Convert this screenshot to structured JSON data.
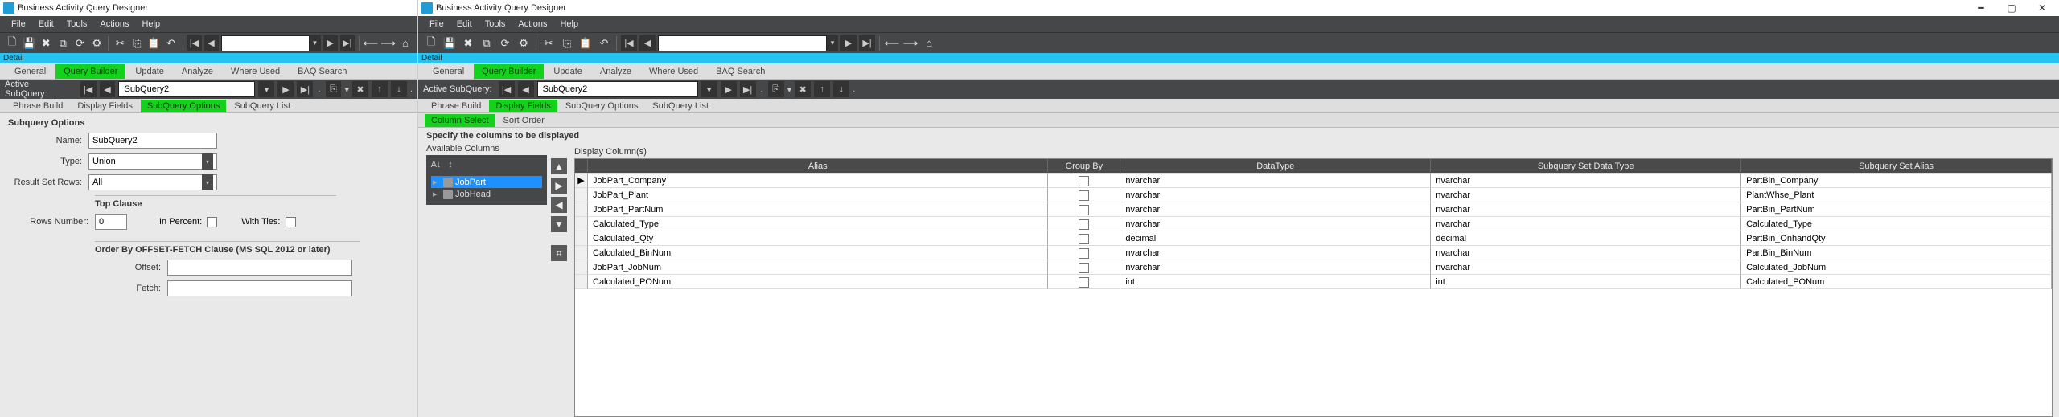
{
  "app_title": "Business Activity Query Designer",
  "menu": [
    "File",
    "Edit",
    "Tools",
    "Actions",
    "Help"
  ],
  "detail_label": "Detail",
  "main_tabs": [
    "General",
    "Query Builder",
    "Update",
    "Analyze",
    "Where Used",
    "BAQ Search"
  ],
  "main_tab_active": 1,
  "subq_label": "Active SubQuery:",
  "subq_value": "SubQuery2",
  "left": {
    "inner_tabs": [
      "Phrase Build",
      "Display Fields",
      "SubQuery Options",
      "SubQuery List"
    ],
    "inner_tab_active": 2,
    "section_title": "Subquery Options",
    "name_label": "Name:",
    "name_value": "SubQuery2",
    "type_label": "Type:",
    "type_value": "Union",
    "rows_label": "Result Set Rows:",
    "rows_value": "All",
    "top_clause_title": "Top Clause",
    "rows_number_label": "Rows Number:",
    "rows_number_value": "0",
    "in_percent_label": "In Percent:",
    "with_ties_label": "With Ties:",
    "orderby_title": "Order By OFFSET-FETCH Clause    (MS SQL 2012 or later)",
    "offset_label": "Offset:",
    "fetch_label": "Fetch:"
  },
  "right": {
    "inner_tabs": [
      "Phrase Build",
      "Display Fields",
      "SubQuery Options",
      "SubQuery List"
    ],
    "inner_tab_active": 1,
    "inner2_tabs": [
      "Column Select",
      "Sort Order"
    ],
    "inner2_active": 0,
    "instruction": "Specify the columns to be displayed",
    "avail_title": "Available Columns",
    "display_title": "Display Column(s)",
    "tree": [
      {
        "label": "JobPart",
        "selected": true
      },
      {
        "label": "JobHead",
        "selected": false
      }
    ],
    "grid_headers": [
      "Alias",
      "Group By",
      "DataType",
      "Subquery Set Data Type",
      "Subquery Set Alias"
    ],
    "grid_rows": [
      {
        "alias": "JobPart_Company",
        "group": false,
        "dtype": "nvarchar",
        "sqtype": "nvarchar",
        "sqalias": "PartBin_Company",
        "active": true
      },
      {
        "alias": "JobPart_Plant",
        "group": false,
        "dtype": "nvarchar",
        "sqtype": "nvarchar",
        "sqalias": "PlantWhse_Plant"
      },
      {
        "alias": "JobPart_PartNum",
        "group": false,
        "dtype": "nvarchar",
        "sqtype": "nvarchar",
        "sqalias": "PartBin_PartNum"
      },
      {
        "alias": "Calculated_Type",
        "group": false,
        "dtype": "nvarchar",
        "sqtype": "nvarchar",
        "sqalias": "Calculated_Type"
      },
      {
        "alias": "Calculated_Qty",
        "group": false,
        "dtype": "decimal",
        "sqtype": "decimal",
        "sqalias": "PartBin_OnhandQty"
      },
      {
        "alias": "Calculated_BinNum",
        "group": false,
        "dtype": "nvarchar",
        "sqtype": "nvarchar",
        "sqalias": "PartBin_BinNum"
      },
      {
        "alias": "JobPart_JobNum",
        "group": false,
        "dtype": "nvarchar",
        "sqtype": "nvarchar",
        "sqalias": "Calculated_JobNum"
      },
      {
        "alias": "Calculated_PONum",
        "group": false,
        "dtype": "int",
        "sqtype": "int",
        "sqalias": "Calculated_PONum"
      }
    ]
  }
}
